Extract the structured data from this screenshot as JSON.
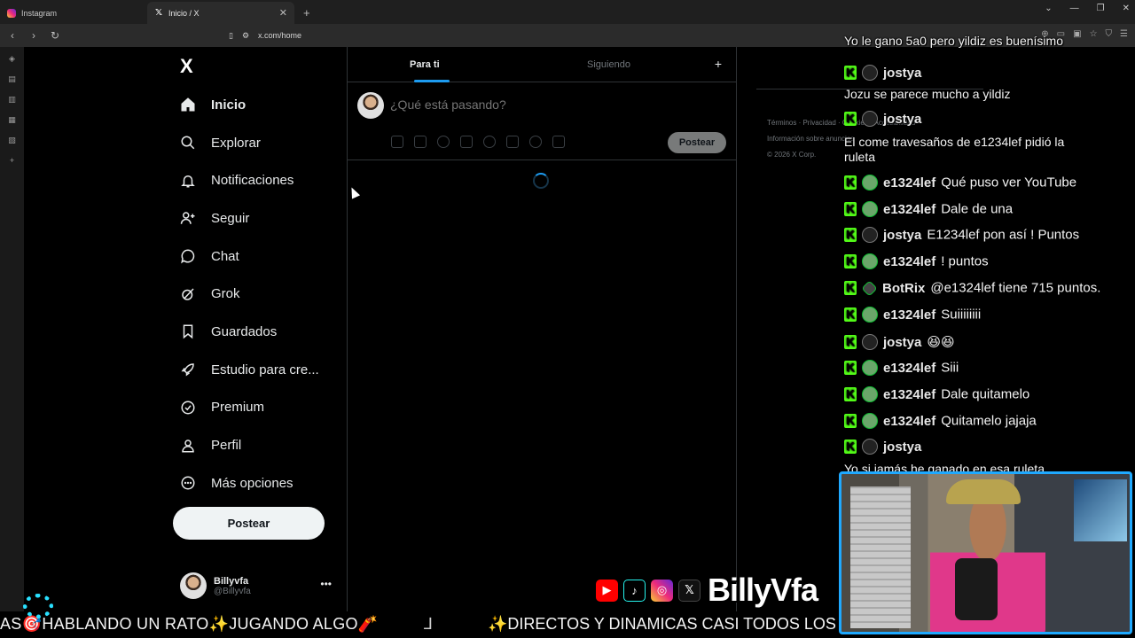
{
  "browser": {
    "tabs": [
      {
        "title": "Instagram"
      },
      {
        "title": "Inicio / X"
      }
    ],
    "url": "x.com/home"
  },
  "x": {
    "logo": "X",
    "nav": [
      {
        "label": "Inicio",
        "icon": "home-icon"
      },
      {
        "label": "Explorar",
        "icon": "search-icon"
      },
      {
        "label": "Notificaciones",
        "icon": "bell-icon"
      },
      {
        "label": "Seguir",
        "icon": "follow-icon"
      },
      {
        "label": "Chat",
        "icon": "chat-icon"
      },
      {
        "label": "Grok",
        "icon": "grok-icon"
      },
      {
        "label": "Guardados",
        "icon": "bookmark-icon"
      },
      {
        "label": "Estudio para cre...",
        "icon": "rocket-icon"
      },
      {
        "label": "Premium",
        "icon": "verified-icon"
      },
      {
        "label": "Perfil",
        "icon": "profile-icon"
      },
      {
        "label": "Más opciones",
        "icon": "more-circle-icon"
      }
    ],
    "post_button": "Postear",
    "account": {
      "name": "Billyvfa",
      "handle": "@Billyvfa"
    },
    "timeline_tabs": {
      "for_you": "Para ti",
      "following": "Siguiendo"
    },
    "compose": {
      "placeholder": "¿Qué está pasando?",
      "post_button": "Postear"
    },
    "footer": {
      "line1": "Términos · Privacidad · Cookies · Accesibilidad",
      "line2": "Información sobre anuncios",
      "copyright": "© 2026 X Corp."
    }
  },
  "chat": {
    "top_line": "Yo le gano 5a0 pero yildiz es buenísimo",
    "messages": [
      {
        "type": "user",
        "user": "jostya",
        "avatar": "user",
        "text": ""
      },
      {
        "type": "plain",
        "text": "Jozu se parece mucho a yildiz"
      },
      {
        "type": "user",
        "user": "jostya",
        "avatar": "user",
        "text": ""
      },
      {
        "type": "plain",
        "text": "El come travesaños de e1234lef pidió la"
      },
      {
        "type": "plain",
        "text": "ruleta"
      },
      {
        "type": "user",
        "user": "e1324lef",
        "avatar": "green",
        "text": "Qué puso ver YouTube"
      },
      {
        "type": "user",
        "user": "e1324lef",
        "avatar": "green",
        "text": "Dale de una"
      },
      {
        "type": "user",
        "user": "jostya",
        "avatar": "user",
        "text": "E1234lef pon así ! Puntos"
      },
      {
        "type": "user",
        "user": "e1324lef",
        "avatar": "green",
        "text": "! puntos"
      },
      {
        "type": "user",
        "user": "BotRix",
        "avatar": "bot",
        "text": "@e1324lef tiene 715 puntos."
      },
      {
        "type": "user",
        "user": "e1324lef",
        "avatar": "green",
        "text": "Suiiiiiiii"
      },
      {
        "type": "user",
        "user": "jostya",
        "avatar": "user",
        "text": "😆😆"
      },
      {
        "type": "user",
        "user": "e1324lef",
        "avatar": "green",
        "text": "Siii"
      },
      {
        "type": "user",
        "user": "e1324lef",
        "avatar": "green",
        "text": "Dale quitamelo"
      },
      {
        "type": "user",
        "user": "e1324lef",
        "avatar": "green",
        "text": "Quitamelo jajaja"
      },
      {
        "type": "user",
        "user": "jostya",
        "avatar": "user",
        "text": ""
      },
      {
        "type": "plain",
        "text": "Yo si jamás he ganado en esa ruleta"
      }
    ]
  },
  "branding": {
    "name": "BillyVfa"
  },
  "ticker": {
    "text1": "AS🎯HABLANDO UN RATO✨JUGANDO ALGO🧨",
    "text2": "✨DIRECTOS Y DINAMICAS CASI TODOS LOS D"
  }
}
